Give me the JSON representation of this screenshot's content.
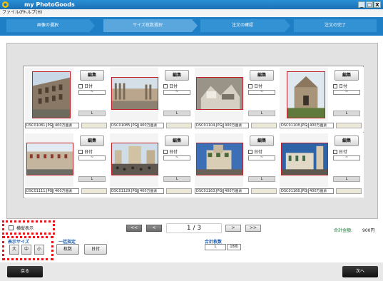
{
  "window": {
    "title": "my PhotoGoods",
    "controls": [
      "_",
      "□",
      "X"
    ]
  },
  "menu": [
    "ファイル(F)",
    "ヘルプ(H)"
  ],
  "steps": [
    {
      "label": "画像の選択",
      "active": false
    },
    {
      "label": "サイズ枚数選択",
      "active": true
    },
    {
      "label": "注文の確認",
      "active": false
    },
    {
      "label": "注文の完了",
      "active": false
    }
  ],
  "photos": [
    {
      "filename": "DSC01081.JPG",
      "pixels": "400万画素",
      "edit": "編集",
      "date_label": "日付",
      "dropdown": "~",
      "size": "L",
      "scene": "colosseum"
    },
    {
      "filename": "DSC01085.JPG",
      "pixels": "400万画素",
      "edit": "編集",
      "date_label": "日付",
      "dropdown": "~",
      "size": "L",
      "scene": "forum"
    },
    {
      "filename": "DSC01104.JPG",
      "pixels": "400万画素",
      "edit": "編集",
      "date_label": "日付",
      "dropdown": "~",
      "size": "L",
      "scene": "ruins"
    },
    {
      "filename": "DSC01108.JPG",
      "pixels": "400万画素",
      "edit": "編集",
      "date_label": "日付",
      "dropdown": "~",
      "size": "L",
      "scene": "church"
    },
    {
      "filename": "DSC01111.JPG",
      "pixels": "400万画素",
      "edit": "編集",
      "date_label": "日付",
      "dropdown": "~",
      "size": "L",
      "scene": "building"
    },
    {
      "filename": "DSC01129.JPG",
      "pixels": "400万画素",
      "edit": "編集",
      "date_label": "日付",
      "dropdown": "~",
      "size": "L",
      "scene": "square"
    },
    {
      "filename": "DSC01163.JPG",
      "pixels": "400万画素",
      "edit": "編集",
      "date_label": "日付",
      "dropdown": "~",
      "size": "L",
      "scene": "cathedral"
    },
    {
      "filename": "DSC01168.JPG",
      "pixels": "400万画素",
      "edit": "編集",
      "date_label": "日付",
      "dropdown": "~",
      "size": "L",
      "scene": "duomo"
    }
  ],
  "pager": {
    "first": "<<",
    "prev": "<",
    "page": "1 / 3",
    "next": ">",
    "last": ">>"
  },
  "total": {
    "label": "合計金額:",
    "value": "900円"
  },
  "options": {
    "vertical_label": "横縦表示",
    "display_size_label": "表示サイズ",
    "sizes": [
      "大",
      "中",
      "小"
    ],
    "batch_label": "一括指定",
    "batch_count": "枚数",
    "batch_date": "日付",
    "total_count_label": "合計枚数",
    "total_count_size": "L",
    "total_count_value": "18枚"
  },
  "footer": {
    "back": "戻る",
    "next": "次へ"
  },
  "colors": {
    "title_bar": "#1c6fb3",
    "step_bar": "#1e7fc6",
    "highlight": "#e8141b",
    "accent_text": "#1a5fb0"
  }
}
